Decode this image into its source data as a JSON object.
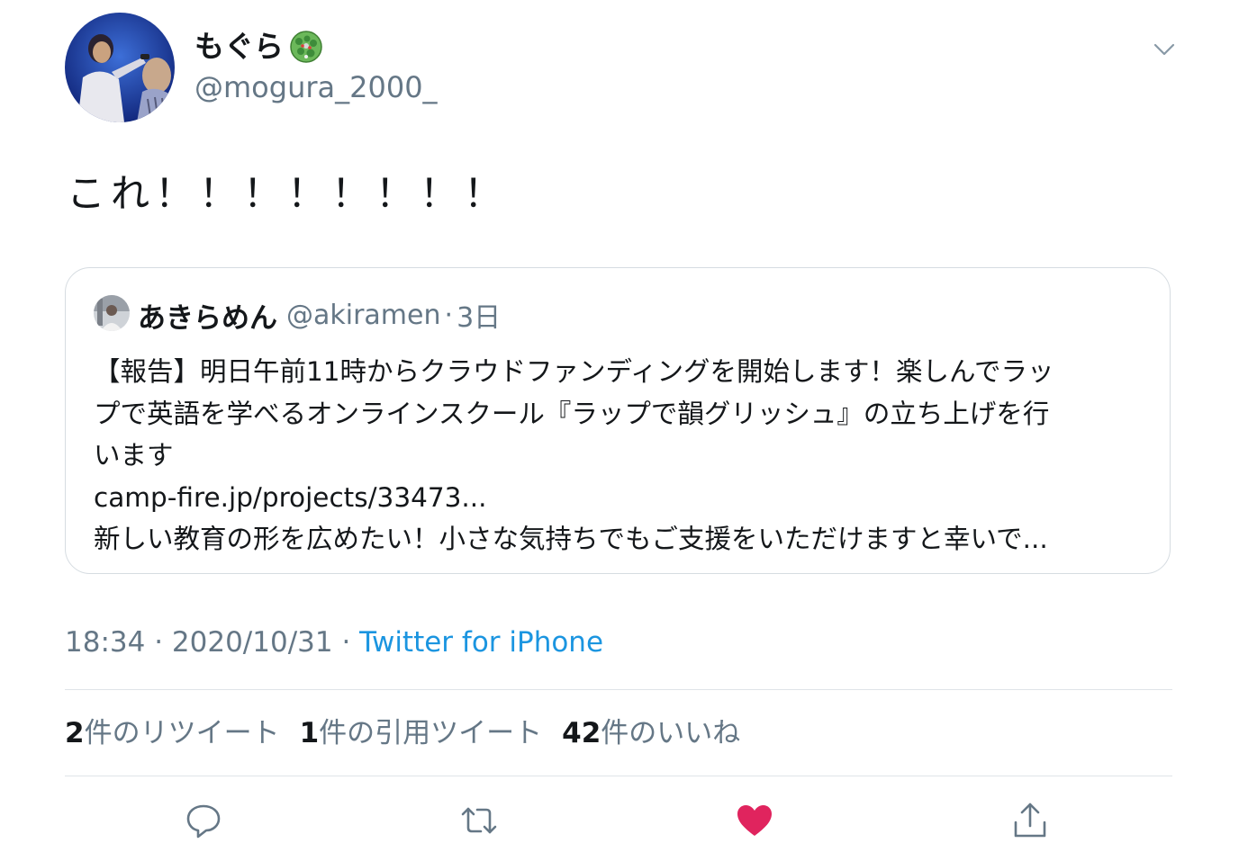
{
  "author": {
    "display_name": "もぐら",
    "name_emoji": "globe-emoji-icon",
    "handle": "@mogura_2000_"
  },
  "tweet": {
    "text": "これ！！！！！！！！"
  },
  "quoted_tweet": {
    "display_name": "あきらめん",
    "handle": "@akiramen",
    "separator": "·",
    "time": "3日",
    "lines": [
      "【報告】明日午前11時からクラウドファンディングを開始します！楽しんでラッ",
      "プで英語を学べるオンラインスクール『ラップで韻グリッシュ』の立ち上げを行",
      "います",
      "camp-fire.jp/projects/33473...",
      "新しい教育の形を広めたい！小さな気持ちでもご支援をいただけますと幸いで..."
    ]
  },
  "meta": {
    "time": "18:34",
    "separator1": " · ",
    "date": "2020/10/31",
    "separator2": " · ",
    "source": "Twitter for iPhone"
  },
  "stats": {
    "retweets_count": "2",
    "retweets_label": "件のリツイート",
    "quotes_count": "1",
    "quotes_label": "件の引用ツイート",
    "likes_count": "42",
    "likes_label": "件のいいね"
  },
  "actions": {
    "reply": "reply-icon",
    "retweet": "retweet-icon",
    "like": "heart-icon",
    "share": "share-icon"
  },
  "colors": {
    "text_primary": "#14171a",
    "text_secondary": "#657786",
    "link": "#1b95e0",
    "like_active": "#e0245e",
    "icon_gray": "#657786",
    "border": "#d6dce1"
  }
}
